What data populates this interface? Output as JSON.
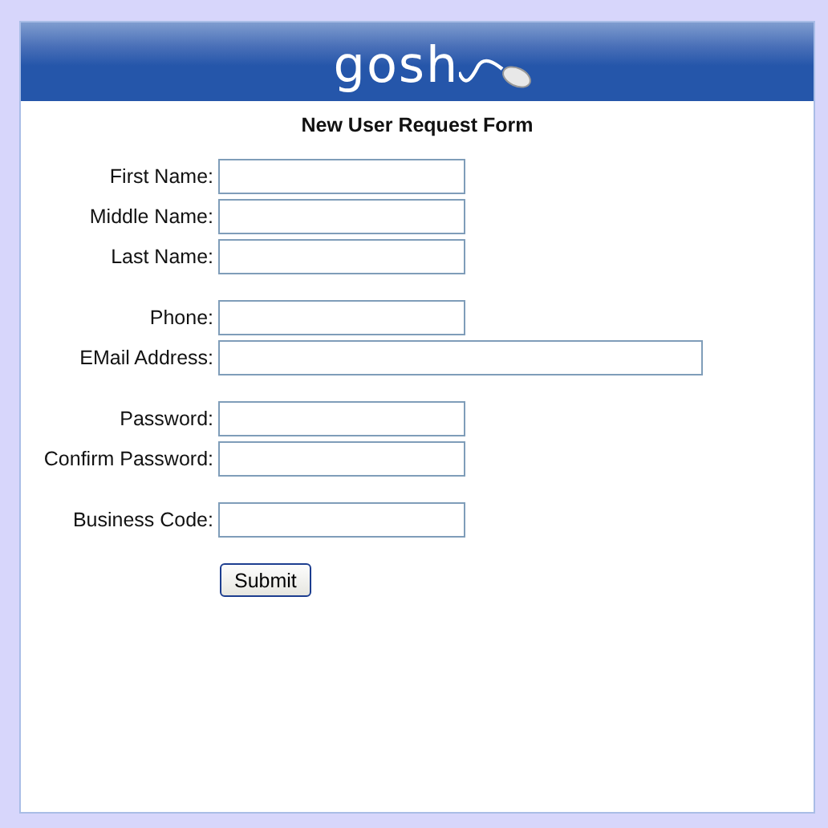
{
  "header": {
    "logo": "gosh"
  },
  "form": {
    "title": "New User Request Form",
    "groups": [
      {
        "fields": [
          {
            "label": "First Name:",
            "kind": "normal"
          },
          {
            "label": "Middle Name:",
            "kind": "normal"
          },
          {
            "label": "Last Name:",
            "kind": "normal"
          }
        ]
      },
      {
        "fields": [
          {
            "label": "Phone:",
            "kind": "normal"
          },
          {
            "label": "EMail Address:",
            "kind": "long"
          }
        ]
      },
      {
        "fields": [
          {
            "label": "Password:",
            "kind": "password"
          },
          {
            "label": "Confirm Password:",
            "kind": "password"
          }
        ]
      },
      {
        "fields": [
          {
            "label": "Business Code:",
            "kind": "normal"
          }
        ]
      }
    ],
    "submit": "Submit"
  }
}
